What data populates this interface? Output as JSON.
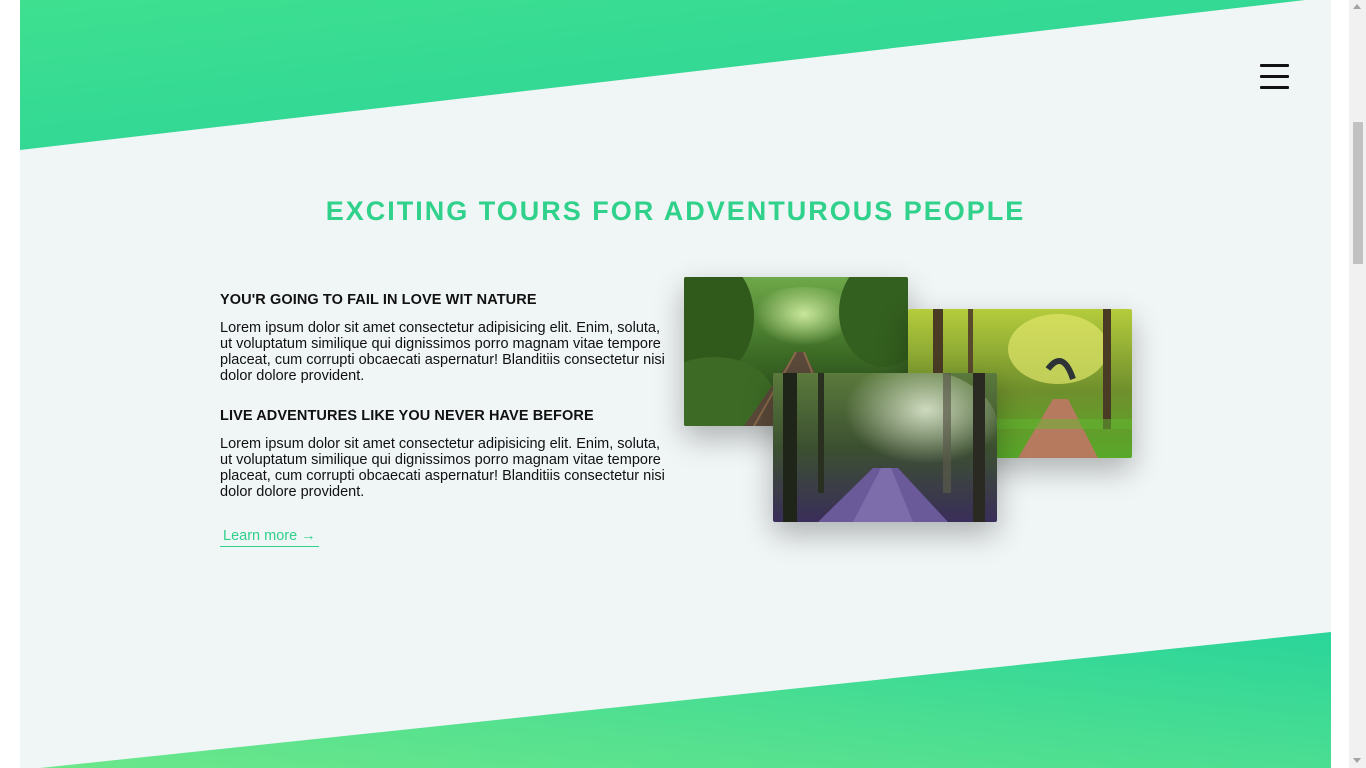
{
  "header": {
    "menu_icon": "hamburger-menu-icon"
  },
  "section": {
    "heading": "EXCITING TOURS FOR ADVENTUROUS PEOPLE",
    "blocks": [
      {
        "title": "YOU'R GOING TO FAIL IN LOVE WIT NATURE",
        "body": "Lorem ipsum dolor sit amet consectetur adipisicing elit. Enim, soluta, ut voluptatum similique qui dignissimos porro magnam vitae tempore placeat, cum corrupti obcaecati aspernatur! Blanditiis consectetur nisi dolor dolore provident."
      },
      {
        "title": "LIVE ADVENTURES LIKE YOU NEVER HAVE BEFORE",
        "body": "Lorem ipsum dolor sit amet consectetur adipisicing elit. Enim, soluta, ut voluptatum similique qui dignissimos porro magnam vitae tempore placeat, cum corrupti obcaecati aspernatur! Blanditiis consectetur nisi dolor dolore provident."
      }
    ],
    "link_label": "Learn more →"
  },
  "colors": {
    "accent": "#2fd18b",
    "background": "#f0f5f5",
    "gradient_light": "#5fe88a",
    "gradient_dark": "#28d49a"
  }
}
